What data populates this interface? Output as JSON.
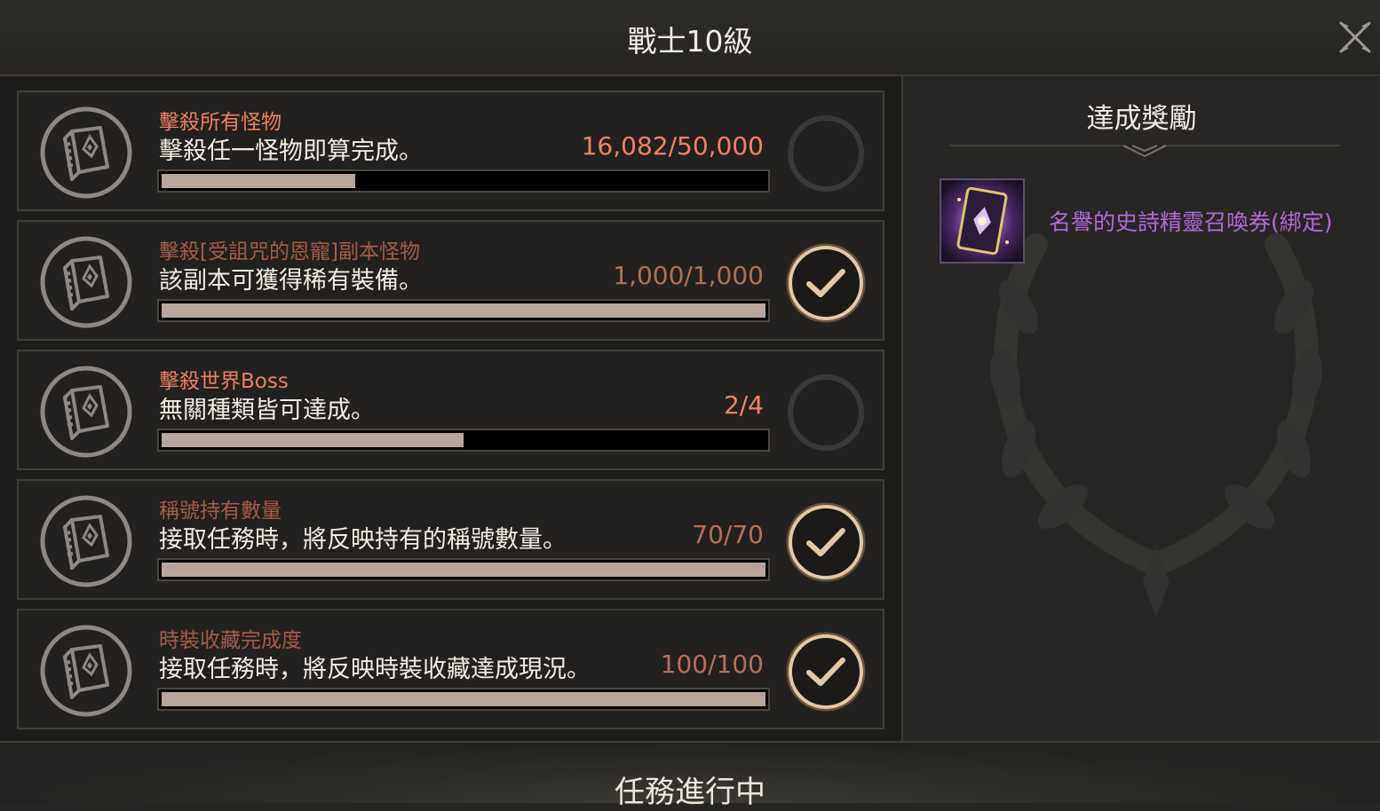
{
  "window": {
    "title": "戰士10級"
  },
  "quests": [
    {
      "title": "擊殺所有怪物",
      "desc": "擊殺任一怪物即算完成。",
      "progress": "16,082/50,000",
      "fraction": 0.32,
      "completed": false
    },
    {
      "title": "擊殺[受詛咒的恩寵]副本怪物",
      "desc": "該副本可獲得稀有裝備。",
      "progress": "1,000/1,000",
      "fraction": 1.0,
      "completed": true
    },
    {
      "title": "擊殺世界Boss",
      "desc": "無關種類皆可達成。",
      "progress": "2/4",
      "fraction": 0.5,
      "completed": false
    },
    {
      "title": "稱號持有數量",
      "desc": "接取任務時，將反映持有的稱號數量。",
      "progress": "70/70",
      "fraction": 1.0,
      "completed": true
    },
    {
      "title": "時裝收藏完成度",
      "desc": "接取任務時，將反映時裝收藏達成現況。",
      "progress": "100/100",
      "fraction": 1.0,
      "completed": true
    }
  ],
  "reward": {
    "heading": "達成獎勵",
    "item_name": "名譽的史詩精靈召喚券(綁定)",
    "item_color": "#b06ad8"
  },
  "footer": {
    "status": "任務進行中"
  },
  "colors": {
    "active_title": "#ee7f5f",
    "done_title": "#a75a47",
    "bar_fill": "#b8a69a",
    "check": "#e2c9a6"
  }
}
